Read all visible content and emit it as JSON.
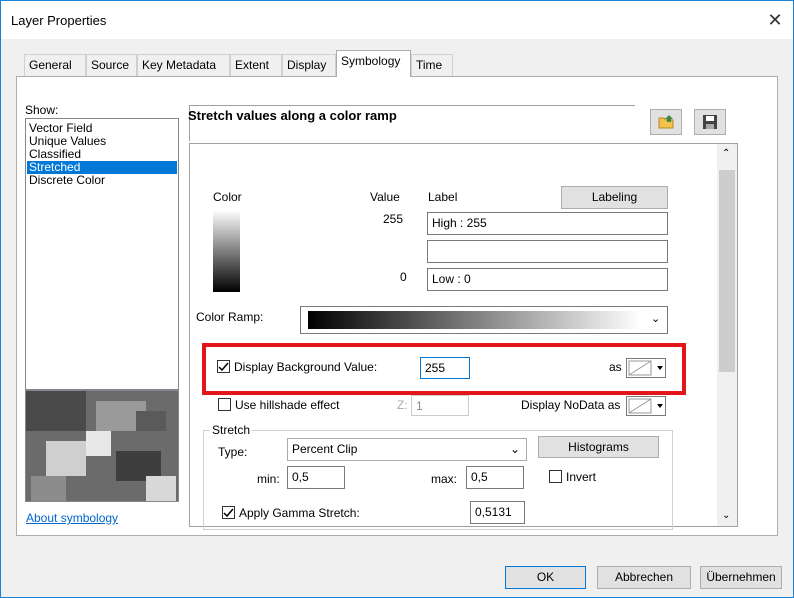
{
  "window": {
    "title": "Layer Properties",
    "close_glyph": "✕"
  },
  "tabs": [
    {
      "label": "General"
    },
    {
      "label": "Source"
    },
    {
      "label": "Key Metadata"
    },
    {
      "label": "Extent"
    },
    {
      "label": "Display"
    },
    {
      "label": "Symbology",
      "active": true
    },
    {
      "label": "Time"
    }
  ],
  "show": {
    "label": "Show:",
    "items": [
      "Vector Field",
      "Unique Values",
      "Classified",
      "Stretched",
      "Discrete Color"
    ],
    "selected": "Stretched"
  },
  "about_link": "About symbology",
  "panel": {
    "header": "Stretch values along a color ramp",
    "col_color": "Color",
    "col_value": "Value",
    "col_label": "Label",
    "labeling_button": "Labeling",
    "high_value": "255",
    "high_label": "High : 255",
    "middle_label": "",
    "low_value": "0",
    "low_label": "Low : 0",
    "color_ramp_label": "Color Ramp:",
    "display_background_label": "Display Background Value:",
    "display_background_value": "255",
    "as_label": "as",
    "hillshade_label": "Use hillshade effect",
    "z_label": "Z:",
    "z_value": "1",
    "nodata_label": "Display NoData as",
    "stretch_group": "Stretch",
    "type_label": "Type:",
    "type_value": "Percent Clip",
    "histograms_button": "Histograms",
    "min_label": "min:",
    "min_value": "0,5",
    "max_label": "max:",
    "max_value": "0,5",
    "invert_label": "Invert",
    "gamma_label": "Apply Gamma Stretch:",
    "gamma_value": "0,5131"
  },
  "buttons": {
    "ok": "OK",
    "cancel": "Abbrechen",
    "apply": "Übernehmen"
  },
  "colors": {
    "accent": "#0078d7",
    "highlight": "#e4141b"
  }
}
